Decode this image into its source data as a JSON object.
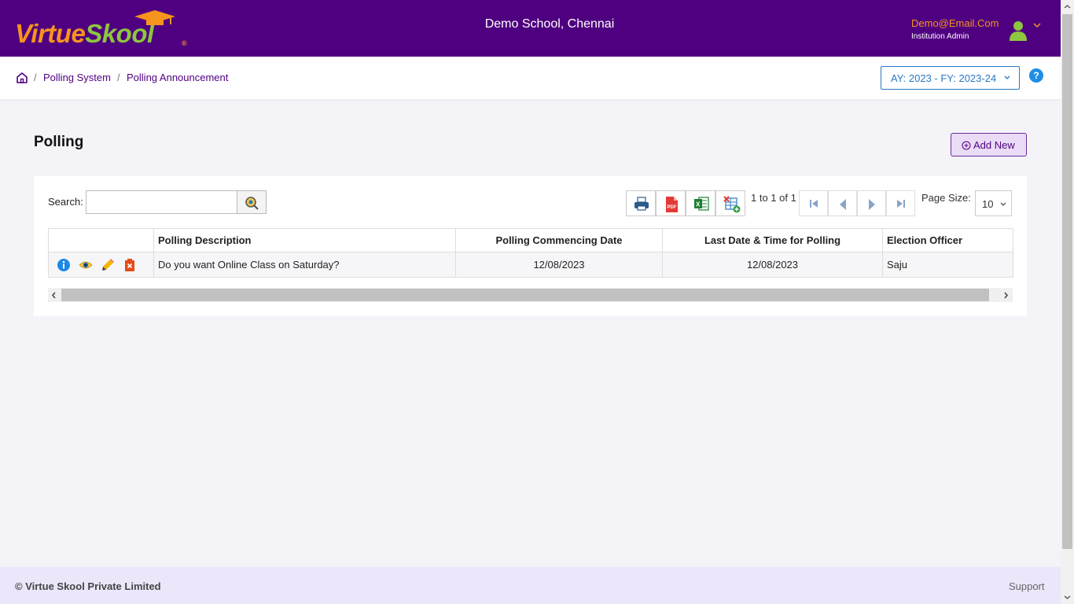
{
  "header": {
    "logo_part1": "Virtue",
    "logo_part2": "Sk",
    "logo_part3": "ol",
    "logo_reg": "®",
    "school_name": "Demo School, Chennai",
    "user_email": "Demo@Email.Com",
    "user_role": "Institution Admin",
    "colors": {
      "bar": "#4f0080",
      "brand_orange": "#f7941d",
      "brand_green": "#8dc63f"
    }
  },
  "breadcrumb": {
    "sep": "/",
    "items": [
      "Polling System",
      "Polling Announcement"
    ]
  },
  "ay_select": {
    "label": "AY: 2023 - FY: 2023-24"
  },
  "help": {
    "label": "?"
  },
  "page": {
    "title": "Polling",
    "add_button": "Add New"
  },
  "toolbar": {
    "search_label": "Search:",
    "search_value": "",
    "tools": [
      "print-icon",
      "pdf-icon",
      "excel-icon",
      "column-chooser-icon"
    ],
    "paging_info": "1 to 1 of 1",
    "page_size_label": "Page Size:",
    "page_size_value": "10"
  },
  "table": {
    "columns": [
      "",
      "Polling Description",
      "Polling Commencing Date",
      "Last Date & Time for Polling",
      "Election Officer"
    ],
    "rows": [
      {
        "actions": [
          "info-icon",
          "view-icon",
          "edit-icon",
          "delete-icon"
        ],
        "description": "Do you want Online Class on Saturday?",
        "commencing_date": "12/08/2023",
        "last_date": "12/08/2023",
        "officer": "Saju"
      }
    ]
  },
  "footer": {
    "copyright": "© Virtue Skool Private Limited",
    "support": "Support"
  }
}
